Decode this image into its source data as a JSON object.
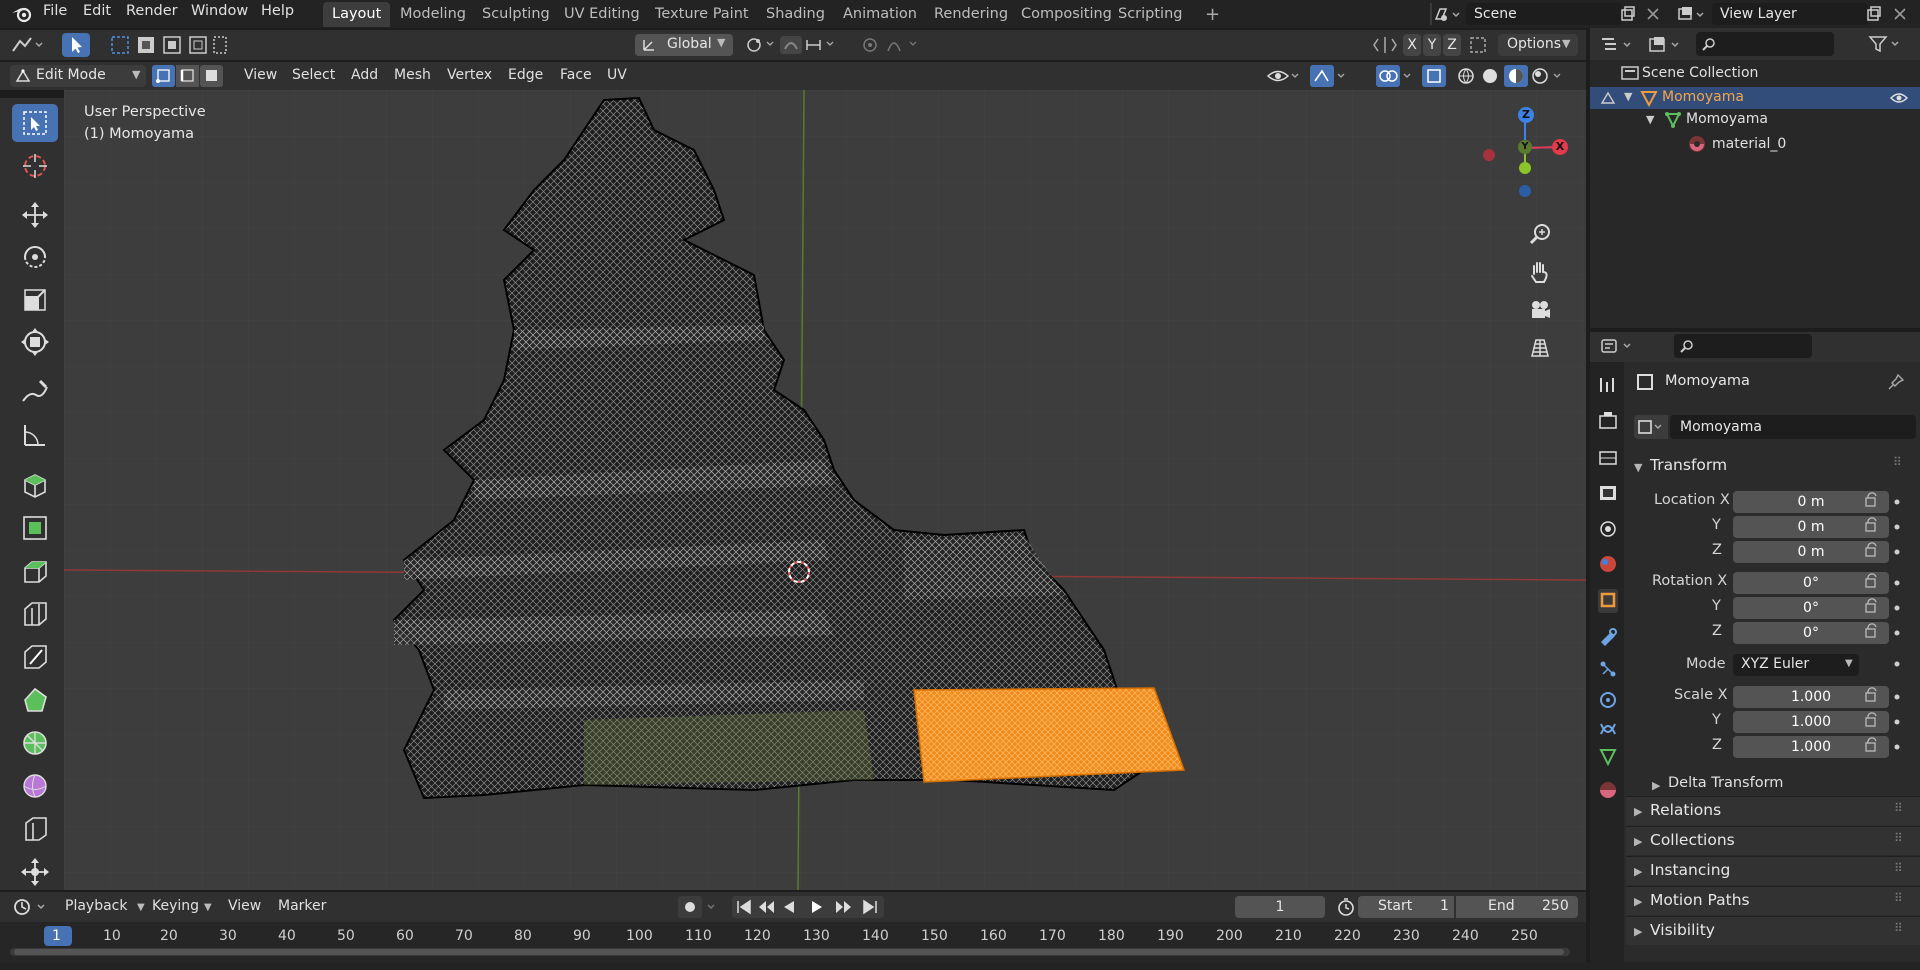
{
  "menu": {
    "items": [
      "File",
      "Edit",
      "Render",
      "Window",
      "Help"
    ],
    "workspaces": [
      "Layout",
      "Modeling",
      "Sculpting",
      "UV Editing",
      "Texture Paint",
      "Shading",
      "Animation",
      "Rendering",
      "Compositing",
      "Scripting"
    ],
    "active_workspace": "Layout",
    "add_tab": "+",
    "scene_name": "Scene",
    "view_layer_name": "View Layer"
  },
  "tool_header": {
    "orientation": "Global",
    "options_label": "Options",
    "axis_x": "X",
    "axis_y": "Y",
    "axis_z": "Z"
  },
  "viewport_header": {
    "mode": "Edit Mode",
    "menus": [
      "View",
      "Select",
      "Add",
      "Mesh",
      "Vertex",
      "Edge",
      "Face",
      "UV"
    ]
  },
  "viewport": {
    "perspective": "User Perspective",
    "object_label": "(1) Momoyama",
    "gizmo": {
      "x": "X",
      "y": "Y",
      "z": "Z"
    }
  },
  "outliner": {
    "root": "Scene Collection",
    "items": [
      {
        "label": "Momoyama",
        "icon": "object-icon",
        "selected": true
      },
      {
        "label": "Momoyama",
        "icon": "mesh-data-icon",
        "selected": false
      },
      {
        "label": "material_0",
        "icon": "material-icon",
        "selected": false
      }
    ]
  },
  "properties": {
    "object_name": "Momoyama",
    "data_name": "Momoyama",
    "transform_title": "Transform",
    "location_x_label": "Location X",
    "rotation_x_label": "Rotation X",
    "scale_x_label": "Scale X",
    "y_label": "Y",
    "z_label": "Z",
    "location": [
      "0 m",
      "0 m",
      "0 m"
    ],
    "rotation": [
      "0°",
      "0°",
      "0°"
    ],
    "mode_label": "Mode",
    "rotation_mode": "XYZ Euler",
    "scale": [
      "1.000",
      "1.000",
      "1.000"
    ],
    "delta_transform": "Delta Transform",
    "sections": [
      "Relations",
      "Collections",
      "Instancing",
      "Motion Paths",
      "Visibility"
    ]
  },
  "timeline": {
    "menus": [
      "Playback",
      "Keying",
      "View",
      "Marker"
    ],
    "current_frame": "1",
    "start_label": "Start",
    "start_value": "1",
    "end_label": "End",
    "end_value": "250",
    "ticks": [
      "1",
      "10",
      "20",
      "30",
      "40",
      "50",
      "60",
      "70",
      "80",
      "90",
      "100",
      "110",
      "120",
      "130",
      "140",
      "150",
      "160",
      "170",
      "180",
      "190",
      "200",
      "210",
      "220",
      "230",
      "240",
      "250"
    ]
  },
  "colors": {
    "accent": "#4772b3",
    "selection_orange": "#f08a1c",
    "x_axis": "#e3394b",
    "y_axis": "#8bc32a",
    "z_axis": "#3b83e6"
  }
}
